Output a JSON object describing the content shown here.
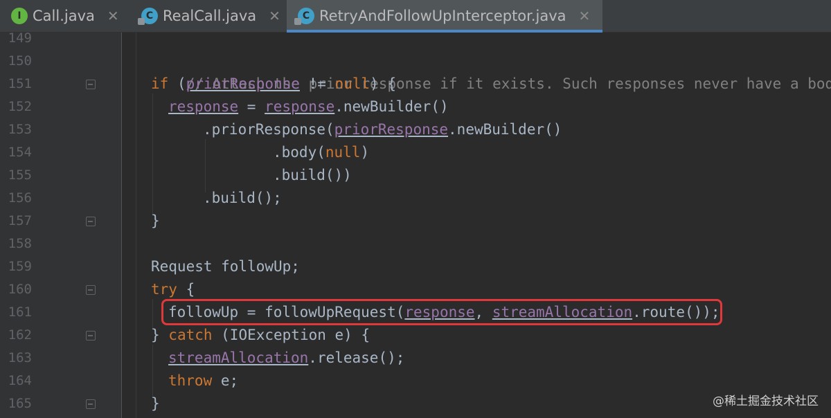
{
  "tabs": [
    {
      "label": "Call.java",
      "icon": "I"
    },
    {
      "label": "RealCall.java",
      "icon": "C"
    },
    {
      "label": "RetryAndFollowUpInterceptor.java",
      "icon": "C"
    }
  ],
  "close_glyph": "✕",
  "line_numbers": [
    "149",
    "150",
    "151",
    "152",
    "153",
    "154",
    "155",
    "156",
    "157",
    "158",
    "159",
    "160",
    "161",
    "162",
    "163",
    "164",
    "165"
  ],
  "code": {
    "l150": "// Attach the prior response if it exists. Such responses never have a body.",
    "l151_kw": "if",
    "l151_a": " (",
    "l151_b": "priorResponse",
    "l151_c": " != ",
    "l151_d": "null",
    "l151_e": ") {",
    "l152_a": "response",
    "l152_b": " = ",
    "l152_c": "response",
    "l152_d": ".newBuilder()",
    "l153_a": ".priorResponse(",
    "l153_b": "priorResponse",
    "l153_c": ".newBuilder()",
    "l154_a": ".body(",
    "l154_b": "null",
    "l154_c": ")",
    "l155": ".build())",
    "l156": ".build();",
    "l157": "}",
    "l159": "Request followUp;",
    "l160_kw": "try",
    "l160_b": " {",
    "l161_a": "followUp = followUpRequest(",
    "l161_b": "response",
    "l161_c": ", ",
    "l161_d": "streamAllocation",
    "l161_e": ".route());",
    "l162_a": "} ",
    "l162_kw": "catch",
    "l162_b": " (IOException e) {",
    "l163_a": "streamAllocation",
    "l163_b": ".release();",
    "l164_kw": "throw",
    "l164_b": " e;",
    "l165": "}"
  },
  "watermark": "@稀土掘金技术社区"
}
